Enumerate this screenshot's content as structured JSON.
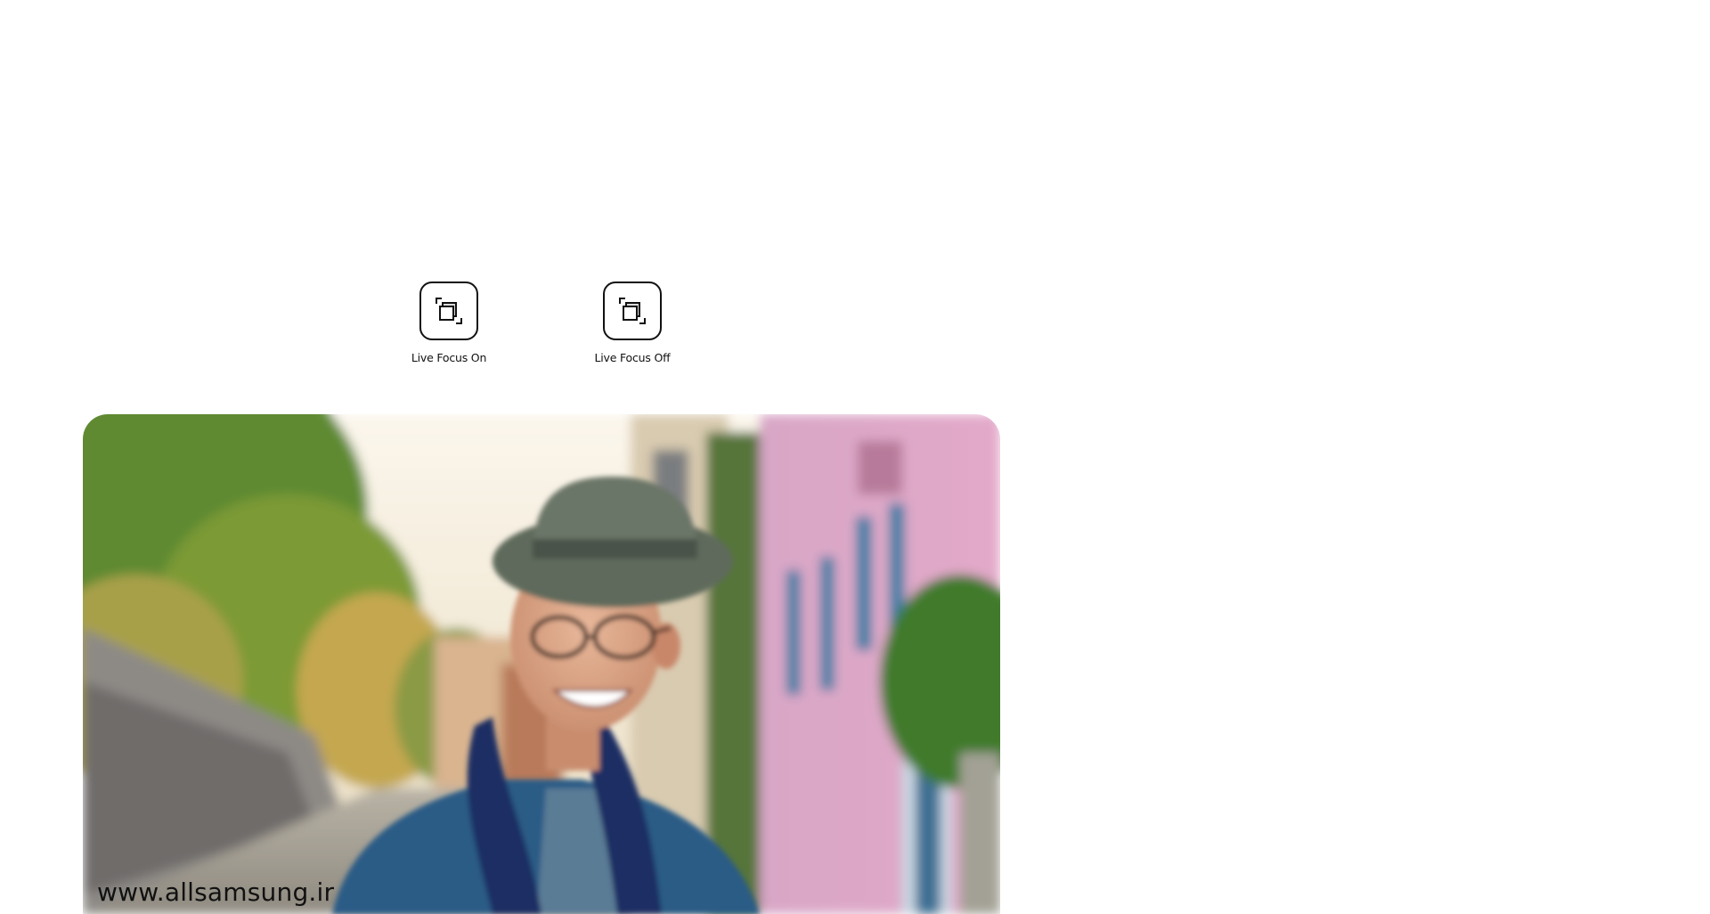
{
  "toggles": [
    {
      "label": "Live Focus On",
      "icon": "live-focus-icon"
    },
    {
      "label": "Live Focus Off",
      "icon": "live-focus-icon"
    }
  ],
  "photo": {
    "watermark": "www.allsamsung.ir"
  },
  "colors": {
    "icon_stroke": "#111111",
    "building_pink": "#d99ac0",
    "shutter_blue": "#3d7fa6",
    "foliage_green": "#5f8a32",
    "jacket_blue": "#2a5b86",
    "scarf_navy": "#1c2f63",
    "hat_gray": "#5f6a5c"
  }
}
